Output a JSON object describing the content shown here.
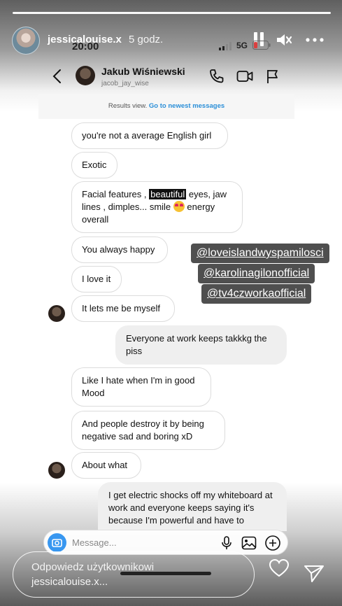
{
  "story": {
    "username": "jessicalouise.x",
    "posted_ago": "5 godz."
  },
  "phone_status": {
    "time": "20:00",
    "network": "5G"
  },
  "chat": {
    "contact_name": "Jakub Wiśniewski",
    "contact_handle": "jacob_jay_wise",
    "results_text": "Results view.",
    "results_link": "Go to newest messages",
    "messages": [
      {
        "dir": "in",
        "text": "you're not a average English girl"
      },
      {
        "dir": "in",
        "text": "Exotic"
      },
      {
        "dir": "in",
        "pre": "Facial features , ",
        "highlight": "beautiful",
        "post": " eyes, jaw lines , dimples... smile ",
        "post2": " energy overall"
      },
      {
        "dir": "in",
        "text": "You always happy"
      },
      {
        "dir": "in",
        "text": "I love it"
      },
      {
        "dir": "in",
        "text": "It lets me be myself"
      },
      {
        "dir": "out",
        "text": "Everyone at work keeps takkkg the piss"
      },
      {
        "dir": "in",
        "text": "Like I hate when I'm in good Mood"
      },
      {
        "dir": "in",
        "text": "And people destroy it by being negative sad and boring xD"
      },
      {
        "dir": "in",
        "text": "About what"
      },
      {
        "dir": "out",
        "text": "I get electric shocks off my whiteboard at work and everyone keeps saying it's because I'm powerful and have to"
      }
    ],
    "composer_placeholder": "Message..."
  },
  "mentions": [
    "@loveislandwyspamilosci",
    "@karolinagilonofficial",
    "@tv4czworkaofficial"
  ],
  "reply": {
    "placeholder_line1": "Odpowiedz użytkownikowi",
    "placeholder_line2": "jessicalouise.x..."
  },
  "colors": {
    "link": "#2b8fd8",
    "camera_button": "#3897f0",
    "mention_bg": "#3c3c3c"
  }
}
